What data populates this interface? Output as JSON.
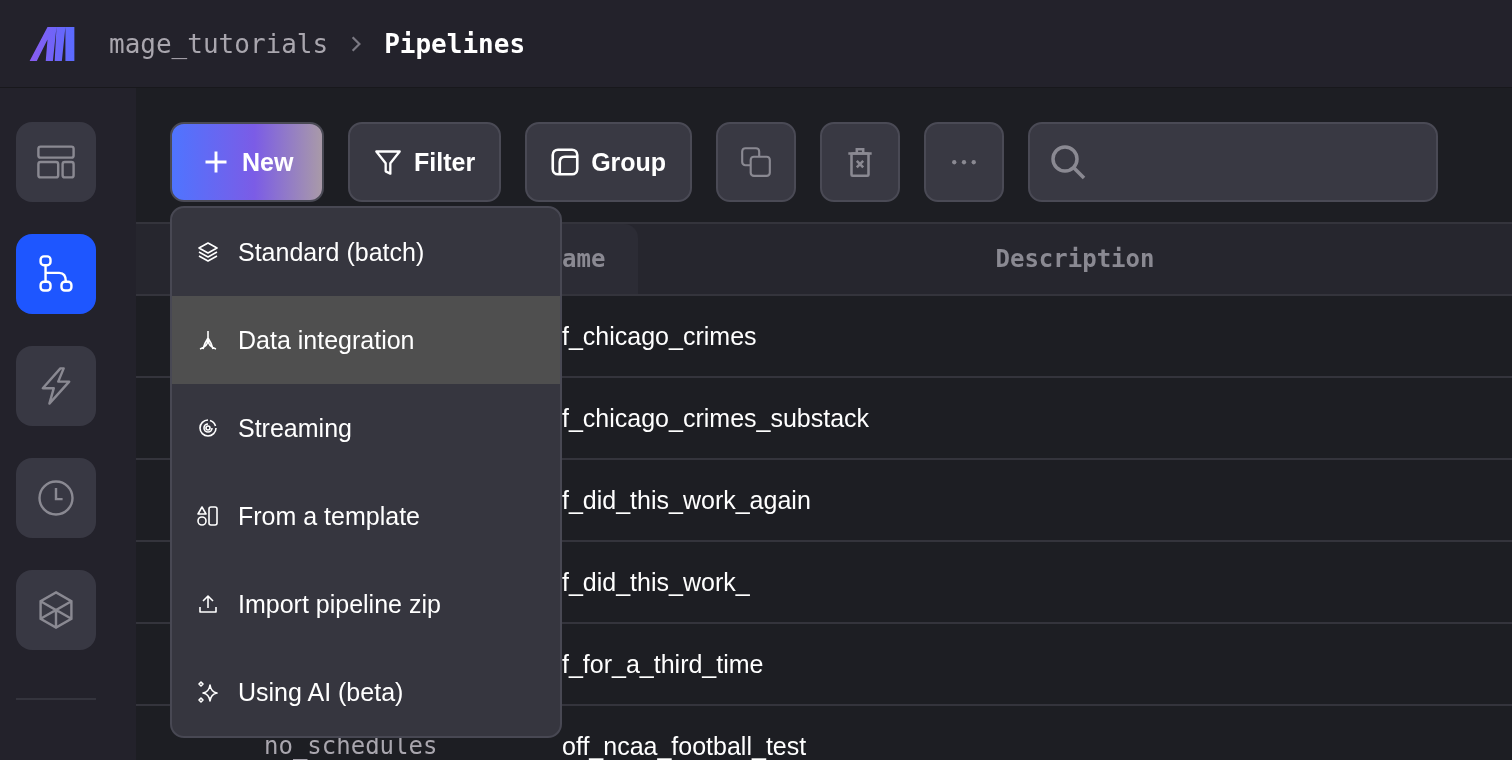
{
  "breadcrumb": {
    "project": "mage_tutorials",
    "page": "Pipelines"
  },
  "sidebar": {
    "items": [
      {
        "kind": "layout",
        "selected": false
      },
      {
        "kind": "pipelines",
        "selected": true
      },
      {
        "kind": "triggers",
        "selected": false
      },
      {
        "kind": "history",
        "selected": false
      },
      {
        "kind": "blocks",
        "selected": false
      }
    ]
  },
  "toolbar": {
    "new_button": "New",
    "filter_button": "Filter",
    "group_button": "Group"
  },
  "new_menu": {
    "items": [
      {
        "kind": "layers",
        "label": "Standard (batch)",
        "selected": false
      },
      {
        "kind": "integration",
        "label": "Data integration",
        "selected": true
      },
      {
        "kind": "streaming",
        "label": "Streaming",
        "selected": false
      },
      {
        "kind": "template",
        "label": "From a template",
        "selected": false
      },
      {
        "kind": "upload",
        "label": "Import pipeline zip",
        "selected": false
      },
      {
        "kind": "ai",
        "label": "Using AI (beta)",
        "selected": false
      }
    ]
  },
  "table": {
    "name_header": "ame",
    "description_header": "Description",
    "rows": [
      {
        "name": "f_chicago_crimes"
      },
      {
        "name": "f_chicago_crimes_substack"
      },
      {
        "name": "f_did_this_work_again"
      },
      {
        "name": "f_did_this_work_"
      },
      {
        "name": "f_for_a_third_time"
      },
      {
        "column_1": "no_schedules",
        "name": "off_ncaa_football_test"
      }
    ]
  }
}
